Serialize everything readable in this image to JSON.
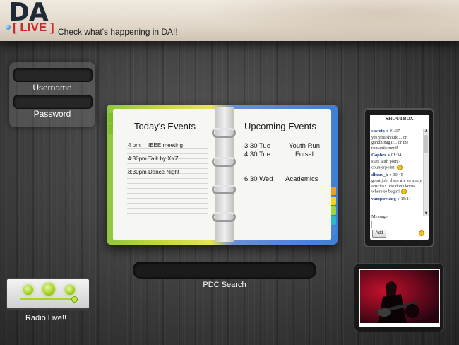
{
  "header": {
    "logo_main": "DA",
    "logo_sub": "[ LIVE ]",
    "tagline": "Check what's happening in DA!!"
  },
  "login": {
    "username_label": "Username",
    "password_label": "Password"
  },
  "planner": {
    "today_heading": "Today's Events",
    "today_events": [
      {
        "time": "4 pm",
        "title": "IEEE meeting"
      },
      {
        "time": "4:30pm",
        "title": "Talk by XYZ"
      },
      {
        "time": "8:30pm",
        "title": "Dance Night"
      }
    ],
    "upcoming_heading": "Upcoming Events",
    "upcoming_events": [
      {
        "time": "3:30 Tue",
        "title": "Youth Run"
      },
      {
        "time": "4:30 Tue",
        "title": "Futsal"
      },
      {
        "time": "6:30 Wed",
        "title": "Academics"
      }
    ]
  },
  "search": {
    "label": "PDC Search"
  },
  "shoutbox": {
    "title": "SHOUTBOX",
    "messages": [
      {
        "user": "shweta",
        "time": "01:37",
        "text": "yes you should... or gandhinagar... or the romantic nerd!"
      },
      {
        "user": "Gopher",
        "time": "01:34",
        "text": "start with point-counterpoint!"
      },
      {
        "user": "dhruv_b",
        "time": "00:45",
        "text": "great job! there are so many articles! Just don't know where to begin!"
      },
      {
        "user": "vampireking",
        "time": "15:11",
        "text": ""
      }
    ],
    "message_label": "Message",
    "add_button": "Add",
    "smile_icon": "smiley-icon",
    "bubble_icon": "speech-bubble-icon"
  },
  "radio": {
    "label": "Radio Live!!",
    "volume": 0.95
  },
  "photo": {
    "alt": "guitarist-photo"
  },
  "colors": {
    "accent_green": "#a9d426",
    "logo_red": "#d0262a",
    "logo_navy": "#1f2a38"
  }
}
